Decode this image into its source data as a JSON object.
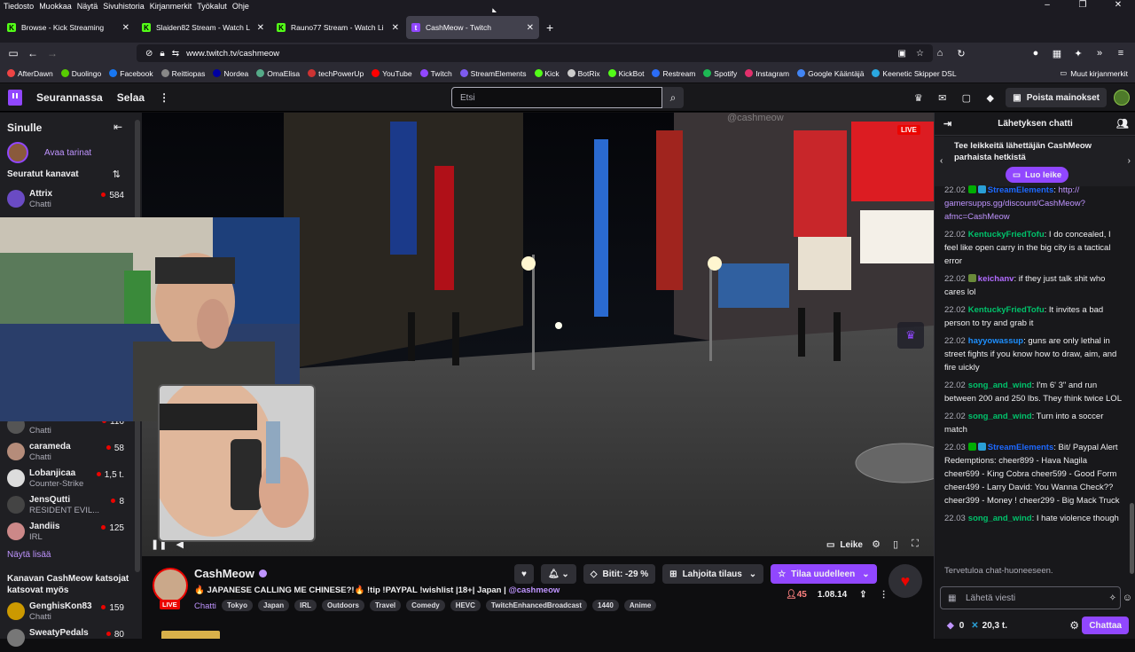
{
  "menubar": [
    "Tiedosto",
    "Muokkaa",
    "Näytä",
    "Sivuhistoria",
    "Kirjanmerkit",
    "Työkalut",
    "Ohje"
  ],
  "tabs": [
    {
      "label": "Browse - Kick Streaming",
      "color": "#53fc18",
      "glyph": "K",
      "active": false
    },
    {
      "label": "Slaiden82 Stream - Watch L",
      "color": "#53fc18",
      "glyph": "K",
      "active": false
    },
    {
      "label": "Rauno77 Stream - Watch Li",
      "color": "#53fc18",
      "glyph": "K",
      "active": false
    },
    {
      "label": "CashMeow - Twitch",
      "color": "#9147ff",
      "glyph": "t",
      "active": true
    }
  ],
  "url": "www.twitch.tv/cashmeow",
  "bookmarks": [
    {
      "label": "AfterDawn",
      "color": "#e44"
    },
    {
      "label": "Duolingo",
      "color": "#58cc02"
    },
    {
      "label": "Facebook",
      "color": "#1877f2"
    },
    {
      "label": "Reittiopas",
      "color": "#888"
    },
    {
      "label": "Nordea",
      "color": "#0000a0"
    },
    {
      "label": "OmaElisa",
      "color": "#5a8"
    },
    {
      "label": "techPowerUp",
      "color": "#c33"
    },
    {
      "label": "YouTube",
      "color": "#f00"
    },
    {
      "label": "Twitch",
      "color": "#9147ff"
    },
    {
      "label": "StreamElements",
      "color": "#7e5bef"
    },
    {
      "label": "Kick",
      "color": "#53fc18"
    },
    {
      "label": "BotRix",
      "color": "#ccc"
    },
    {
      "label": "KickBot",
      "color": "#53fc18"
    },
    {
      "label": "Restream",
      "color": "#2b6cf6"
    },
    {
      "label": "Spotify",
      "color": "#1db954"
    },
    {
      "label": "Instagram",
      "color": "#e1306c"
    },
    {
      "label": "Google Kääntäjä",
      "color": "#4285f4"
    },
    {
      "label": "Keenetic Skipper DSL",
      "color": "#2aa7e0"
    }
  ],
  "bookmarks_other": "Muut kirjanmerkit",
  "header": {
    "following": "Seurannassa",
    "browse": "Selaa",
    "search_placeholder": "Etsi",
    "ad_button": "Poista mainokset"
  },
  "sidebar": {
    "title": "Sinulle",
    "stories": "Avaa tarinat",
    "followed_title": "Seuratut kanavat",
    "channels": [
      {
        "name": "Attrix",
        "game": "Chatti",
        "viewers": "584",
        "color": "#6a4bc4"
      },
      {
        "name": "",
        "game": "Chatti",
        "viewers": "116",
        "color": "#555"
      },
      {
        "name": "carameda",
        "game": "Chatti",
        "viewers": "58",
        "color": "#b58c7a"
      },
      {
        "name": "Lobanjicaa",
        "game": "Counter-Strike",
        "viewers": "1,5 t.",
        "color": "#ddd"
      },
      {
        "name": "JensQutti",
        "game": "RESIDENT EVIL...",
        "viewers": "8",
        "color": "#444"
      },
      {
        "name": "Jandiis",
        "game": "IRL",
        "viewers": "125",
        "color": "#c88"
      }
    ],
    "show_more": "Näytä lisää",
    "also_watch": "Kanavan CashMeow katsojat katsovat myös",
    "also_channels": [
      {
        "name": "GenghisKon83",
        "game": "Chatti",
        "viewers": "159",
        "color": "#c90"
      },
      {
        "name": "SweatyPedals",
        "game": "",
        "viewers": "80",
        "color": "#777"
      }
    ]
  },
  "video": {
    "watermark": "@cashmeow",
    "live": "LIVE",
    "clip": "Leike"
  },
  "info": {
    "channel": "CashMeow",
    "live_tag": "LIVE",
    "title": "🔥 JAPANESE CALLING ME CHINESE?!🔥 !tip !PAYPAL !wishlist |18+| Japan | ",
    "title_handle": "@cashmeow",
    "category": "Chatti",
    "tags": [
      "Tokyo",
      "Japan",
      "IRL",
      "Outdoors",
      "Travel",
      "Comedy",
      "HEVC",
      "TwitchEnhancedBroadcast",
      "1440",
      "Anime"
    ],
    "bits": "Bitit: -29 %",
    "gift": "Lahjoita tilaus",
    "subscribe": "Tilaa uudelleen",
    "viewers": "45",
    "uptime": "1.08.14"
  },
  "chat": {
    "title": "Lähetyksen chatti",
    "promo": "Tee leikkeitä lähettäjän CashMeow parhaista hetkistä",
    "clip_button": "Luo leike",
    "messages": [
      {
        "time": "22.02",
        "user": "StreamElements",
        "color": "#1e69ff",
        "text": "",
        "link": "http:// gamersupps.gg/discount/CashMeow? afmc=CashMeow",
        "badges": true
      },
      {
        "time": "22.02",
        "user": "KentuckyFriedTofu",
        "color": "#00c26b",
        "text": ": I do concealed, I feel like open carry in the big city is a tactical error",
        "link": "",
        "badges": false
      },
      {
        "time": "22.02",
        "user": "keichanv",
        "color": "#b16bff",
        "text": ": if they just talk shit who cares lol",
        "link": "",
        "badges": false
      },
      {
        "time": "22.02",
        "user": "KentuckyFriedTofu",
        "color": "#00c26b",
        "text": ": It invites a bad person to try and grab it",
        "link": "",
        "badges": false
      },
      {
        "time": "22.02",
        "user": "hayyowassup",
        "color": "#1e90ff",
        "text": ": guns are only lethal in street fights if you know how to draw, aim, and fire uickly",
        "link": "",
        "badges": false
      },
      {
        "time": "22.02",
        "user": "song_and_wind",
        "color": "#00c26b",
        "text": ": I'm 6' 3\" and run between 200 and 250 lbs. They think twice LOL",
        "link": "",
        "badges": false
      },
      {
        "time": "22.02",
        "user": "song_and_wind",
        "color": "#00c26b",
        "text": ": Turn into a soccer match",
        "link": "",
        "badges": false
      },
      {
        "time": "22.03",
        "user": "StreamElements",
        "color": "#1e69ff",
        "text": ": Bit/ Paypal Alert Redemptions: cheer899 - Hava Nagila cheer699 - King Cobra cheer599 - Good Form cheer499 - Larry David: You Wanna Check?? cheer399 - Money ! cheer299 - Big Mack Truck",
        "link": "",
        "badges": true
      },
      {
        "time": "22.03",
        "user": "song_and_wind",
        "color": "#00c26b",
        "text": ": I hate violence though",
        "link": "",
        "badges": false
      }
    ],
    "welcome": "Tervetuloa chat-huoneeseen.",
    "input_placeholder": "Lähetä viesti",
    "points": "0",
    "bits_count": "20,3 t.",
    "send": "Chattaa"
  }
}
